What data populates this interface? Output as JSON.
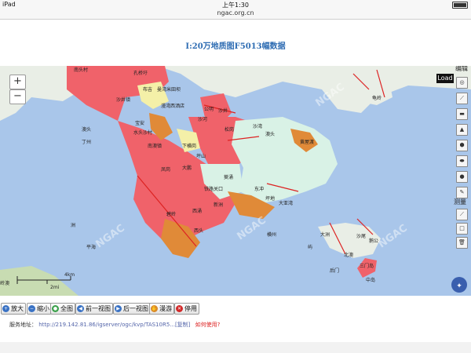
{
  "status_bar": {
    "carrier": "iPad",
    "clock": "上午1:30"
  },
  "browser": {
    "url": "ngac.org.cn"
  },
  "page": {
    "title": "I:20万地质图F5013幅数据"
  },
  "map": {
    "zoom_in": "+",
    "zoom_out": "−",
    "side_panel": {
      "edit_label": "编辑",
      "measure_label": "测量",
      "load_tooltip": "Load"
    },
    "scale": {
      "top": "4km",
      "bottom": "2mi"
    },
    "places": [
      "南头村",
      "孔桥圩",
      "布吉",
      "曼湾米田坝",
      "漫湾西洒店",
      "沙井镇",
      "宝安",
      "公明",
      "沙河",
      "水头沙村",
      "南澳镇",
      "沙井",
      "松岗",
      "下横岗",
      "坪山",
      "沙湾",
      "澳头",
      "大鹏",
      "凤岗",
      "铁路关口",
      "葵涌",
      "东冲",
      "坪地",
      "大亚湾",
      "碧岭",
      "西涌",
      "新洲",
      "西头",
      "三门岛",
      "龟岭",
      "黄屋渡",
      "澳头",
      "丁州",
      "沙尾",
      "鹅公",
      "洲",
      "大洲",
      "横州",
      "平海",
      "屿",
      "岭澳",
      "中岛",
      "后门",
      "北澳"
    ],
    "watermark": "NGAC",
    "colors": {
      "sea": "#a9c6ea",
      "land": "#e9eee6",
      "red_unit": "#f0626a",
      "light_unit": "#d9f2e6",
      "orange_unit": "#e08a38",
      "yellow_unit": "#f4f0a8"
    }
  },
  "toolbar": {
    "buttons": [
      {
        "label": "放大",
        "icon": "zoom-in-icon",
        "color": "#3a72c4"
      },
      {
        "label": "缩小",
        "icon": "zoom-out-icon",
        "color": "#3a72c4"
      },
      {
        "label": "全图",
        "icon": "globe-icon",
        "color": "#3aa04a"
      },
      {
        "label": "前一视图",
        "icon": "back-icon",
        "color": "#3a72c4"
      },
      {
        "label": "后一视图",
        "icon": "forward-icon",
        "color": "#3a72c4"
      },
      {
        "label": "漫游",
        "icon": "hand-icon",
        "color": "#d98a2a"
      },
      {
        "label": "停用",
        "icon": "stop-icon",
        "color": "#d22a2a"
      }
    ]
  },
  "service": {
    "label": "服务地址：",
    "url": "http://219.142.81.86/igserver/ogc/kvp/TAS10R5...[复制]",
    "help": "如何使用?"
  }
}
